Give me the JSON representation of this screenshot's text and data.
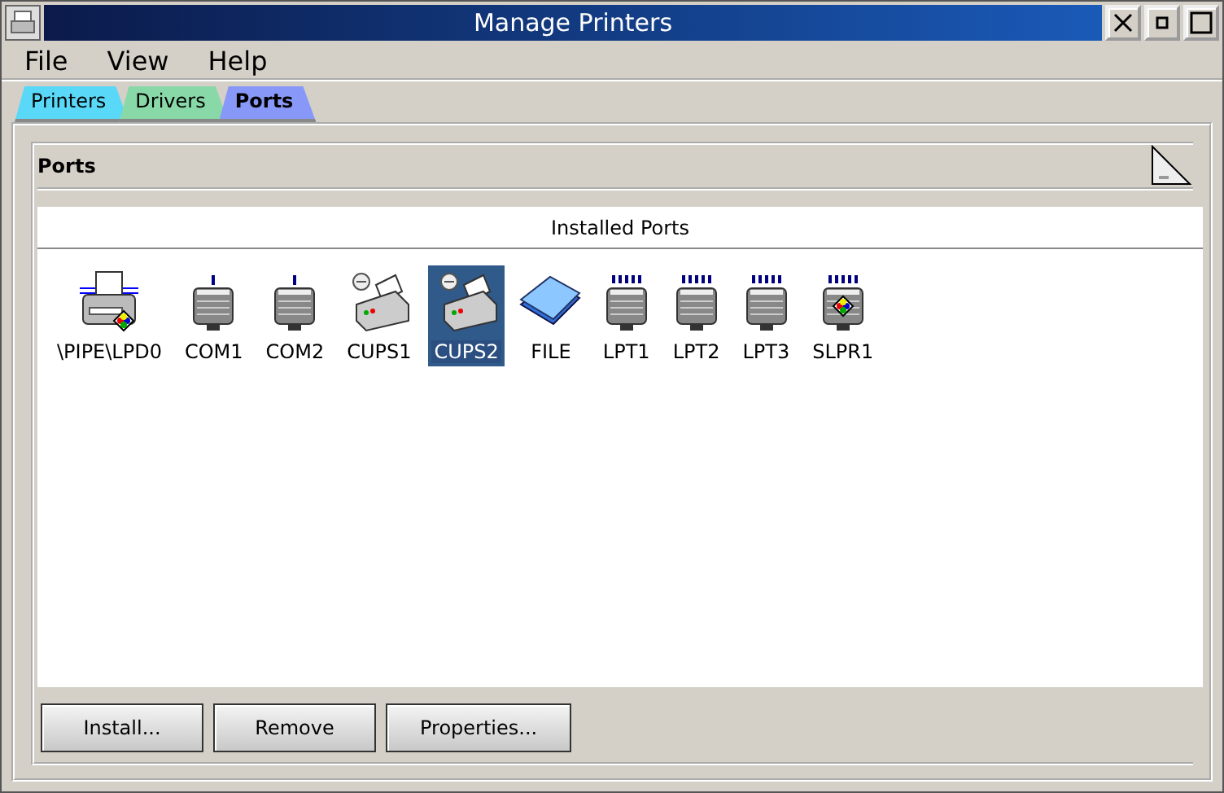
{
  "window": {
    "title": "Manage Printers"
  },
  "menu": [
    {
      "label": "File"
    },
    {
      "label": "View"
    },
    {
      "label": "Help"
    }
  ],
  "tabs": [
    {
      "label": "Printers",
      "selected": false,
      "color": "#5ad8f8"
    },
    {
      "label": "Drivers",
      "selected": false,
      "color": "#88d8a8"
    },
    {
      "label": "Ports",
      "selected": true,
      "color": "#8898f8"
    }
  ],
  "page": {
    "title": "Ports"
  },
  "list": {
    "heading": "Installed Ports",
    "items": [
      {
        "label": "\\PIPE\\LPD0",
        "kind": "pipe",
        "selected": false
      },
      {
        "label": "COM1",
        "kind": "serial",
        "selected": false
      },
      {
        "label": "COM2",
        "kind": "serial",
        "selected": false
      },
      {
        "label": "CUPS1",
        "kind": "cups",
        "selected": false
      },
      {
        "label": "CUPS2",
        "kind": "cups",
        "selected": true
      },
      {
        "label": "FILE",
        "kind": "file",
        "selected": false
      },
      {
        "label": "LPT1",
        "kind": "parallel",
        "selected": false
      },
      {
        "label": "LPT2",
        "kind": "parallel",
        "selected": false
      },
      {
        "label": "LPT3",
        "kind": "parallel",
        "selected": false
      },
      {
        "label": "SLPR1",
        "kind": "slpr",
        "selected": false
      }
    ]
  },
  "buttons": [
    {
      "label": "Install..."
    },
    {
      "label": "Remove"
    },
    {
      "label": "Properties..."
    }
  ]
}
